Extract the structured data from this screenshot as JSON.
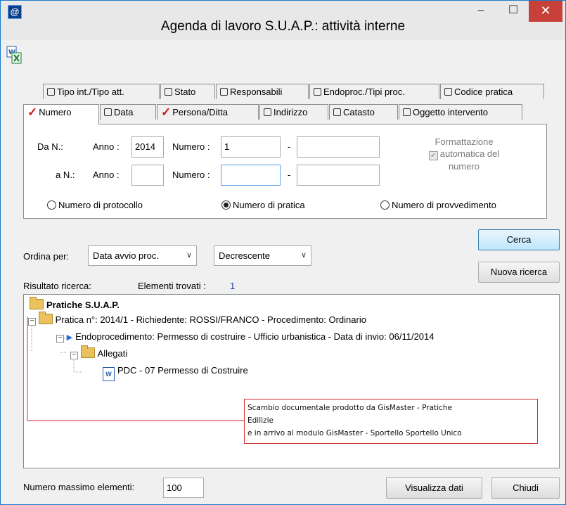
{
  "window": {
    "title": "Agenda di lavoro S.U.A.P.: attività interne",
    "app_icon": "@",
    "controls": {
      "minimize": "–",
      "maximize": "☐",
      "close": "✕"
    }
  },
  "toolbar": {
    "export_icon": "excel-export-icon"
  },
  "tabs": {
    "row1": [
      {
        "label": "Tipo int./Tipo att.",
        "checked": false
      },
      {
        "label": "Stato",
        "checked": false
      },
      {
        "label": "Responsabili",
        "checked": false
      },
      {
        "label": "Endoproc./Tipi proc.",
        "checked": false
      },
      {
        "label": "Codice pratica",
        "checked": false
      }
    ],
    "row2": [
      {
        "label": "Numero",
        "checked": true,
        "active": true
      },
      {
        "label": "Data",
        "checked": false
      },
      {
        "label": "Persona/Ditta",
        "checked": true
      },
      {
        "label": "Indirizzo",
        "checked": false
      },
      {
        "label": "Catasto",
        "checked": false
      },
      {
        "label": "Oggetto intervento",
        "checked": false
      }
    ]
  },
  "numero_panel": {
    "da_label": "Da N.:",
    "a_label": "a N.:",
    "anno_label": "Anno :",
    "numero_label": "Numero :",
    "dash": "-",
    "da_anno": "2014",
    "da_numero": "1",
    "da_suffix": "",
    "a_anno": "",
    "a_numero": "",
    "a_suffix": "",
    "format_checkbox_label": "automatica del",
    "format_line1": "Formattazione",
    "format_line3": "numero",
    "format_checked": true,
    "radio_options": [
      "Numero di protocollo",
      "Numero di pratica",
      "Numero di provvedimento"
    ],
    "radio_selected": "Numero di pratica"
  },
  "sort": {
    "label": "Ordina per:",
    "field": "Data avvio proc.",
    "direction": "Decrescente"
  },
  "buttons": {
    "cerca": "Cerca",
    "nuova_ricerca": "Nuova ricerca",
    "visualizza_dati": "Visualizza dati",
    "chiudi": "Chiudi"
  },
  "results": {
    "label": "Risultato ricerca:",
    "found_label": "Elementi trovati :",
    "found_count": "1"
  },
  "tree": {
    "root": "Pratiche S.U.A.P.",
    "pratica": "Pratica n°: 2014/1 - Richiedente: ROSSI/FRANCO - Procedimento: Ordinario",
    "endoproc": "Endoprocedimento: Permesso di costruire - Ufficio urbanistica - Data di invio: 06/11/2014",
    "allegati": "Allegati",
    "document": "PDC - 07 Permesso di Costruire"
  },
  "annotation": {
    "line1": "Scambio documentale prodotto da GisMaster - Pratiche",
    "line2": "Edilizie",
    "line3": "e in arrivo al modulo GisMaster - Sportello Sportello Unico"
  },
  "footer": {
    "max_label": "Numero massimo elementi:",
    "max_value": "100"
  },
  "colors": {
    "window_border": "#1979ca",
    "close_button": "#c7413a",
    "tab_check": "#d0141a",
    "annotation_border": "#d42d2d",
    "found_count": "#1f3fb5"
  }
}
